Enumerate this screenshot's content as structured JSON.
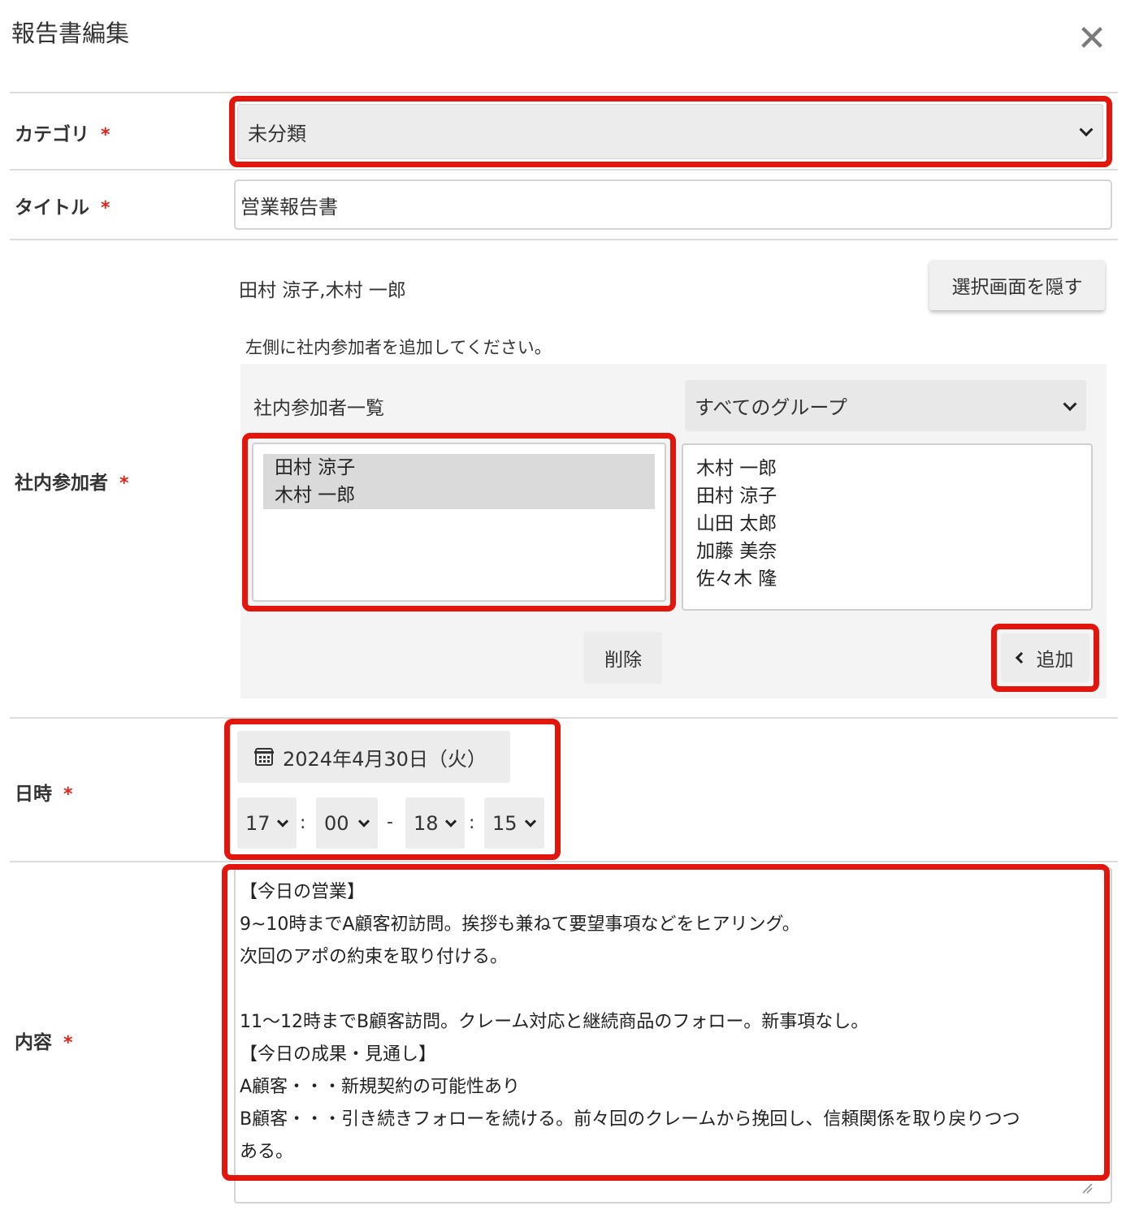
{
  "modal": {
    "title": "報告書編集",
    "close_glyph": "✕"
  },
  "category": {
    "label": "カテゴリ",
    "required": "*",
    "selected": "未分類"
  },
  "title_field": {
    "label": "タイトル",
    "required": "*",
    "value": "営業報告書"
  },
  "participants": {
    "label": "社内参加者",
    "required": "*",
    "selected_summary": "田村 涼子,木村 一郎",
    "hide_button": "選択画面を隠す",
    "instruction": "左側に社内参加者を追加してください。",
    "list_heading": "社内参加者一覧",
    "group_select": "すべてのグループ",
    "selected_list": [
      "田村 涼子",
      "木村 一郎"
    ],
    "available_list": [
      "木村 一郎",
      "田村 涼子",
      "山田 太郎",
      "加藤 美奈",
      "佐々木 隆"
    ],
    "delete_button": "削除",
    "add_button": "追加"
  },
  "datetime": {
    "label": "日時",
    "required": "*",
    "date": "2024年4月30日（火）",
    "start_hour": "17",
    "start_min": "00",
    "end_hour": "18",
    "end_min": "15",
    "colon": ":",
    "dash": "-"
  },
  "content": {
    "label": "内容",
    "required": "*",
    "lines": [
      "【今日の営業】",
      "9~10時までA顧客初訪問。挨拶も兼ねて要望事項などをヒアリング。",
      "次回のアポの約束を取り付ける。",
      "",
      "11〜12時までB顧客訪問。クレーム対応と継続商品のフォロー。新事項なし。",
      "【今日の成果・見通し】",
      "A顧客・・・新規契約の可能性あり",
      "B顧客・・・引き続きフォローを続ける。前々回のクレームから挽回し、信頼関係を取り戻りつつ",
      "ある。"
    ]
  },
  "colors": {
    "highlight": "#e3160e",
    "required": "#e0241b"
  }
}
